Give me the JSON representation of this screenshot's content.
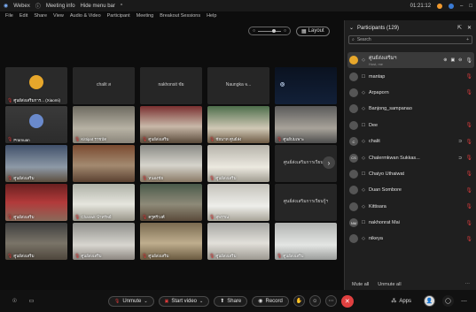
{
  "titlebar": {
    "app": "Webex",
    "meeting_info": "Meeting info",
    "hide_menu": "Hide menu bar",
    "time": "01:21:12",
    "min": "–",
    "max": "□"
  },
  "menu": [
    "File",
    "Edit",
    "Share",
    "View",
    "Audio & Video",
    "Participant",
    "Meeting",
    "Breakout Sessions",
    "Help"
  ],
  "view": {
    "layout_label": "Layout"
  },
  "tiles": [
    {
      "name": "ศูนย์ส่งเสริมการ... (Xiaomi)",
      "scene": "logo"
    },
    {
      "name": "",
      "center": "chalit ส",
      "scene": "dark"
    },
    {
      "name": "",
      "center": "nakhonsit ชัย",
      "scene": "dark"
    },
    {
      "name": "",
      "center": "Naungka จ...",
      "scene": "dark"
    },
    {
      "name": "",
      "scene": "camo"
    },
    {
      "name": "Pramuan",
      "scene": "logo2"
    },
    {
      "name": "Kittipat ราชบัด",
      "scene": "office"
    },
    {
      "name": "ศูนย์ส่งเสริม",
      "scene": "room"
    },
    {
      "name": "ชัยนาท ศูนย์ส่ง",
      "scene": "room2"
    },
    {
      "name": "ศูนย์บ่มเพาะ",
      "scene": "hall"
    },
    {
      "name": "ศูนย์ส่งเสริม",
      "scene": "room3"
    },
    {
      "name": "",
      "scene": "office2"
    },
    {
      "name": "หนองชัย",
      "scene": "meeting"
    },
    {
      "name": "ศูนย์ส่งเสริม",
      "scene": "room4"
    },
    {
      "name": "",
      "center": "ศูนย์ส่งเสริมการเรียนรู้ฯ",
      "scene": "dark"
    },
    {
      "name": "ศูนย์ส่งเสริม",
      "scene": "slide"
    },
    {
      "name": "Chanwit นำทรัพย์",
      "scene": "office3"
    },
    {
      "name": "ครูศรีวงศ์",
      "scene": "person"
    },
    {
      "name": "สุพรรณ",
      "scene": "room5"
    },
    {
      "name": "",
      "center": "ศูนย์ส่งเสริมการเรียนรู้ฯ",
      "scene": "dark"
    },
    {
      "name": "ศูนย์ส่งเสริม",
      "scene": "person2"
    },
    {
      "name": "ศูนย์ส่งเสริม",
      "scene": "person3"
    },
    {
      "name": "ศูนย์ส่งเสริม",
      "scene": "room6"
    },
    {
      "name": "ศูนย์ส่งเสริม",
      "scene": "room7"
    },
    {
      "name": "ศูนย์ส่งเสริม",
      "scene": "office4"
    }
  ],
  "panel": {
    "title": "Participants (129)",
    "search_placeholder": "Search",
    "participants": [
      {
        "name": "ศูนย์ส่งเสริมฯ",
        "sub": "Host, me",
        "initials": "",
        "logo": true,
        "mic": "on"
      },
      {
        "name": "mantap",
        "initials": "",
        "mic": "off"
      },
      {
        "name": "Arpaporn",
        "initials": "",
        "mic": "off"
      },
      {
        "name": "Banjong_sampanao",
        "initials": "",
        "mic": "none"
      },
      {
        "name": "Dee",
        "initials": "",
        "mic": "off"
      },
      {
        "name": "chalit",
        "initials": "C",
        "mic": "off"
      },
      {
        "name": "Chalermkwan Sukkas...",
        "initials": "CS",
        "mic": "off"
      },
      {
        "name": "Chaiyo Uthaiwat",
        "initials": "",
        "mic": "off"
      },
      {
        "name": "Duan Sombore",
        "initials": "",
        "mic": "off"
      },
      {
        "name": "Kittisara",
        "initials": "",
        "mic": "off"
      },
      {
        "name": "nakhonrat Mai",
        "initials": "NM",
        "mic": "off"
      },
      {
        "name": "nikeya",
        "initials": "",
        "mic": "off"
      }
    ],
    "mute_all": "Mute all",
    "unmute_all": "Unmute all"
  },
  "toolbar": {
    "unmute": "Unmute",
    "start_video": "Start video",
    "share": "Share",
    "record": "Record",
    "apps": "Apps"
  },
  "colors": {
    "leave": "#e04040",
    "mic_muted": "#d63b3b",
    "accent": "#f29a2e"
  }
}
